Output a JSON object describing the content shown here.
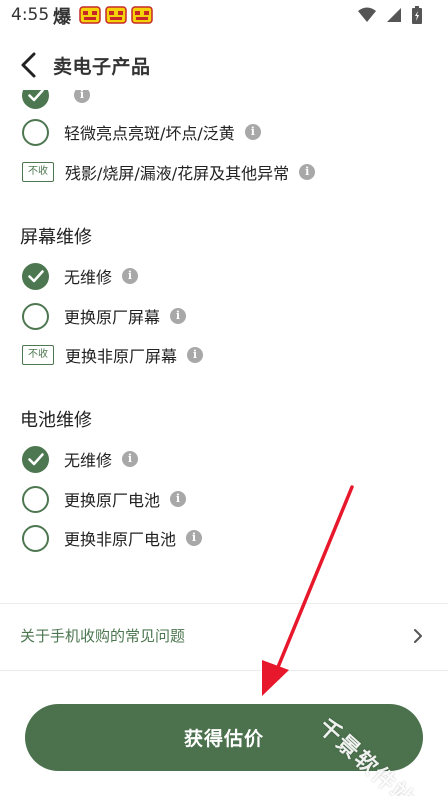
{
  "status_bar": {
    "time": "4:55",
    "burst_char": "爆",
    "icons": [
      "notification-badge-icon",
      "notification-badge-icon",
      "notification-badge-icon",
      "wifi-icon",
      "signal-icon",
      "battery-icon"
    ]
  },
  "header": {
    "title": "卖电子产品"
  },
  "display_section": {
    "options": [
      {
        "label": "",
        "checked": true,
        "no_buy": false
      },
      {
        "label": "轻微亮点亮斑/坏点/泛黄",
        "checked": false,
        "no_buy": false
      },
      {
        "label": "残影/烧屏/漏液/花屏及其他异常",
        "checked": false,
        "no_buy": true
      }
    ]
  },
  "screen_repair": {
    "title": "屏幕维修",
    "options": [
      {
        "label": "无维修",
        "checked": true,
        "no_buy": false
      },
      {
        "label": "更换原厂屏幕",
        "checked": false,
        "no_buy": false
      },
      {
        "label": "更换非原厂屏幕",
        "checked": false,
        "no_buy": true
      }
    ]
  },
  "battery_repair": {
    "title": "电池维修",
    "options": [
      {
        "label": "无维修",
        "checked": true,
        "no_buy": false
      },
      {
        "label": "更换原厂电池",
        "checked": false,
        "no_buy": false
      },
      {
        "label": "更换非原厂电池",
        "checked": false,
        "no_buy": false
      }
    ]
  },
  "no_buy_tag": "不收",
  "info_glyph": "i",
  "faq": {
    "label": "关于手机收购的常见问题"
  },
  "cta": {
    "label": "获得估价"
  },
  "watermark": "千景软件站",
  "colors": {
    "accent": "#4d7750",
    "button": "#4b714d",
    "arrow": "#e8182c"
  }
}
